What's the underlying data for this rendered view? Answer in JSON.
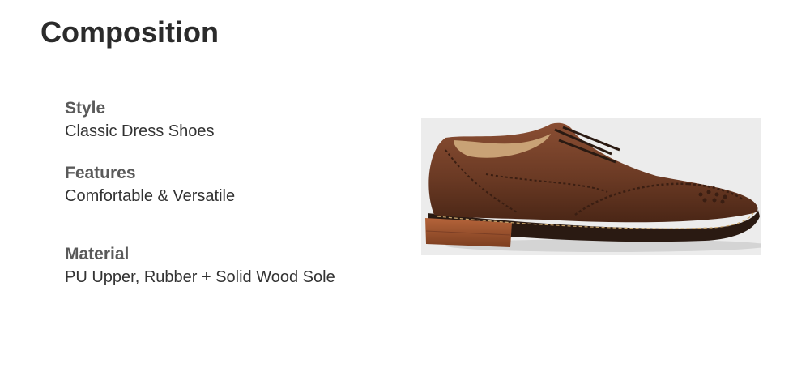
{
  "section": {
    "title": "Composition"
  },
  "specs": [
    {
      "label": "Style",
      "value": "Classic Dress Shoes"
    },
    {
      "label": "Features",
      "value": "Comfortable & Versatile"
    },
    {
      "label": "Material",
      "value": "PU Upper, Rubber + Solid Wood Sole"
    }
  ],
  "image": {
    "background_color": "#ececec",
    "shoe_color": "#6b3a24",
    "heel_color": "#a0522d"
  }
}
